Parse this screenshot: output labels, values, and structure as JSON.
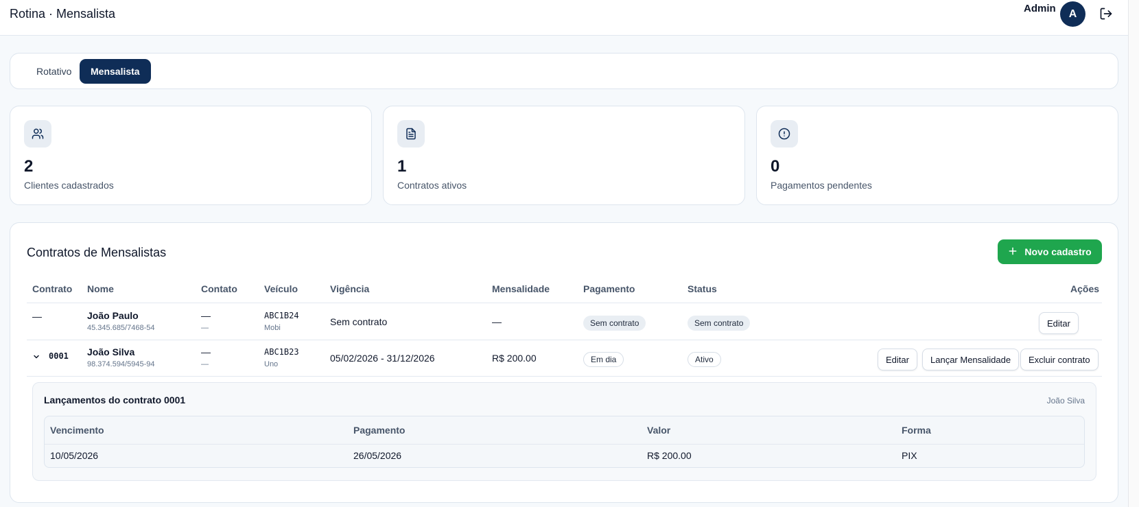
{
  "header": {
    "title": "Rotina · Mensalista",
    "user_name": "Admin",
    "avatar_initial": "A"
  },
  "tabs": [
    {
      "label": "Rotativo",
      "active": false
    },
    {
      "label": "Mensalista",
      "active": true
    }
  ],
  "stats": [
    {
      "value": "2",
      "label": "Clientes cadastrados",
      "icon": "users-icon"
    },
    {
      "value": "1",
      "label": "Contratos ativos",
      "icon": "document-icon"
    },
    {
      "value": "0",
      "label": "Pagamentos pendentes",
      "icon": "alert-circle-icon"
    }
  ],
  "contracts": {
    "title": "Contratos de Mensalistas",
    "new_button": "Novo cadastro",
    "columns": [
      "Contrato",
      "Nome",
      "Contato",
      "Veículo",
      "Vigência",
      "Mensalidade",
      "Pagamento",
      "Status",
      "Ações"
    ],
    "rows": [
      {
        "contrato": "—",
        "nome": "João Paulo",
        "documento": "45.345.685/7468-54",
        "contato": "—",
        "contato2": "—",
        "placa": "ABC1B24",
        "modelo": "Mobi",
        "vigencia": "Sem contrato",
        "mensalidade": "—",
        "pagamento": "Sem contrato",
        "status": "Sem contrato",
        "actions": [
          "Editar"
        ]
      },
      {
        "contrato": "0001",
        "nome": "João Silva",
        "documento": "98.374.594/5945-94",
        "contato": "—",
        "contato2": "—",
        "placa": "ABC1B23",
        "modelo": "Uno",
        "vigencia": "05/02/2026 - 31/12/2026",
        "mensalidade": "R$ 200.00",
        "pagamento": "Em dia",
        "status": "Ativo",
        "actions": [
          "Editar",
          "Lançar Mensalidade",
          "Excluir contrato"
        ]
      }
    ]
  },
  "launches": {
    "title": "Lançamentos do contrato 0001",
    "client": "João Silva",
    "columns": [
      "Vencimento",
      "Pagamento",
      "Valor",
      "Forma"
    ],
    "rows": [
      {
        "vencimento": "10/05/2026",
        "pagamento": "26/05/2026",
        "valor": "R$ 200.00",
        "forma": "PIX"
      }
    ]
  },
  "colors": {
    "primary": "#0f2d57",
    "success": "#1fa64e",
    "background": "#f6f9fc"
  }
}
